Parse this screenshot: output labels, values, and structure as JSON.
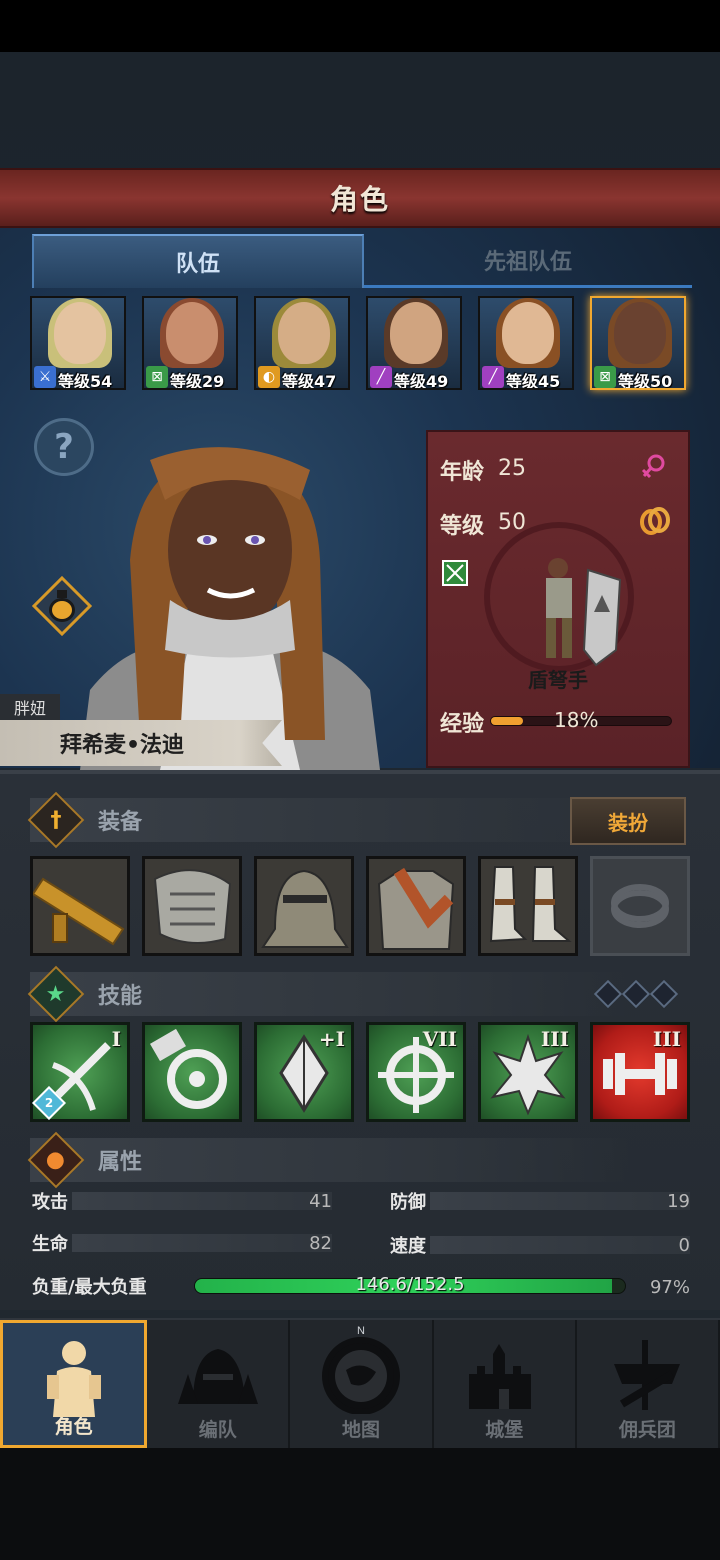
{
  "header": {
    "title": "角色"
  },
  "tabs": [
    {
      "label": "队伍",
      "active": true
    },
    {
      "label": "先祖队伍",
      "active": false
    }
  ],
  "party": [
    {
      "level_label": "等级54",
      "class_icon": "sword-icon",
      "class_color": "#3a6fd0",
      "hair": "#c9c07a",
      "skin": "#e4c3a0",
      "selected": false
    },
    {
      "level_label": "等级29",
      "class_icon": "crossbow-icon",
      "class_color": "#3a9a48",
      "hair": "#8a4a30",
      "skin": "#c98e6e",
      "selected": false
    },
    {
      "level_label": "等级47",
      "class_icon": "shield-icon",
      "class_color": "#e09a20",
      "hair": "#9c8a3a",
      "skin": "#d5ad86",
      "selected": false
    },
    {
      "level_label": "等级49",
      "class_icon": "staff-icon",
      "class_color": "#a040c0",
      "hair": "#5a3a28",
      "skin": "#d0a480",
      "selected": false
    },
    {
      "level_label": "等级45",
      "class_icon": "staff-icon",
      "class_color": "#a040c0",
      "hair": "#8a5024",
      "skin": "#e0b894",
      "selected": false
    },
    {
      "level_label": "等级50",
      "class_icon": "crossbow-icon",
      "class_color": "#3a9a48",
      "hair": "#7a4a26",
      "skin": "#6a4230",
      "selected": true
    }
  ],
  "character": {
    "nickname": "胖妞",
    "name": "拜希麦•法迪",
    "age_label": "年龄",
    "age": "25",
    "level_label": "等级",
    "level": "50",
    "class_name": "盾弩手",
    "exp_label": "经验",
    "exp_percent_text": "18%",
    "exp_fraction": 0.18,
    "gender_icon": "female-icon",
    "ring_icon": "ring-icon",
    "class_icon": "crossbow-icon"
  },
  "equipment": {
    "label": "装备",
    "dress_button": "装扮",
    "slots": [
      "crossbow-icon",
      "shoulder-armor-icon",
      "helmet-icon",
      "chest-armor-icon",
      "boots-icon",
      "ring-slot-icon"
    ]
  },
  "skills": {
    "label": "技能",
    "items": [
      {
        "icon": "sword-crossbow-skill-icon",
        "rank": "I",
        "badge": "2",
        "color": "green"
      },
      {
        "icon": "target-hammer-skill-icon",
        "rank": "",
        "color": "green"
      },
      {
        "icon": "crystal-skill-icon",
        "rank": "+I",
        "color": "green"
      },
      {
        "icon": "crosshair-skill-icon",
        "rank": "VII",
        "color": "green"
      },
      {
        "icon": "burst-skill-icon",
        "rank": "III",
        "color": "green"
      },
      {
        "icon": "dumbbell-skill-icon",
        "rank": "III",
        "color": "red"
      }
    ]
  },
  "attributes": {
    "label": "属性",
    "attack_label": "攻击",
    "attack": "41",
    "defense_label": "防御",
    "defense": "19",
    "hp_label": "生命",
    "hp": "82",
    "speed_label": "速度",
    "speed": "0",
    "load_label": "负重/最大负重",
    "load_text": "146.6/152.5",
    "load_percent": "97%",
    "load_fraction": 0.97
  },
  "nav": [
    {
      "label": "角色",
      "icon": "knight-icon",
      "active": true
    },
    {
      "label": "编队",
      "icon": "helmet-formation-icon",
      "active": false
    },
    {
      "label": "地图",
      "icon": "compass-map-icon",
      "active": false,
      "compass_mark": "N"
    },
    {
      "label": "城堡",
      "icon": "castle-icon",
      "active": false
    },
    {
      "label": "佣兵团",
      "icon": "mercenary-flag-icon",
      "active": false
    }
  ]
}
